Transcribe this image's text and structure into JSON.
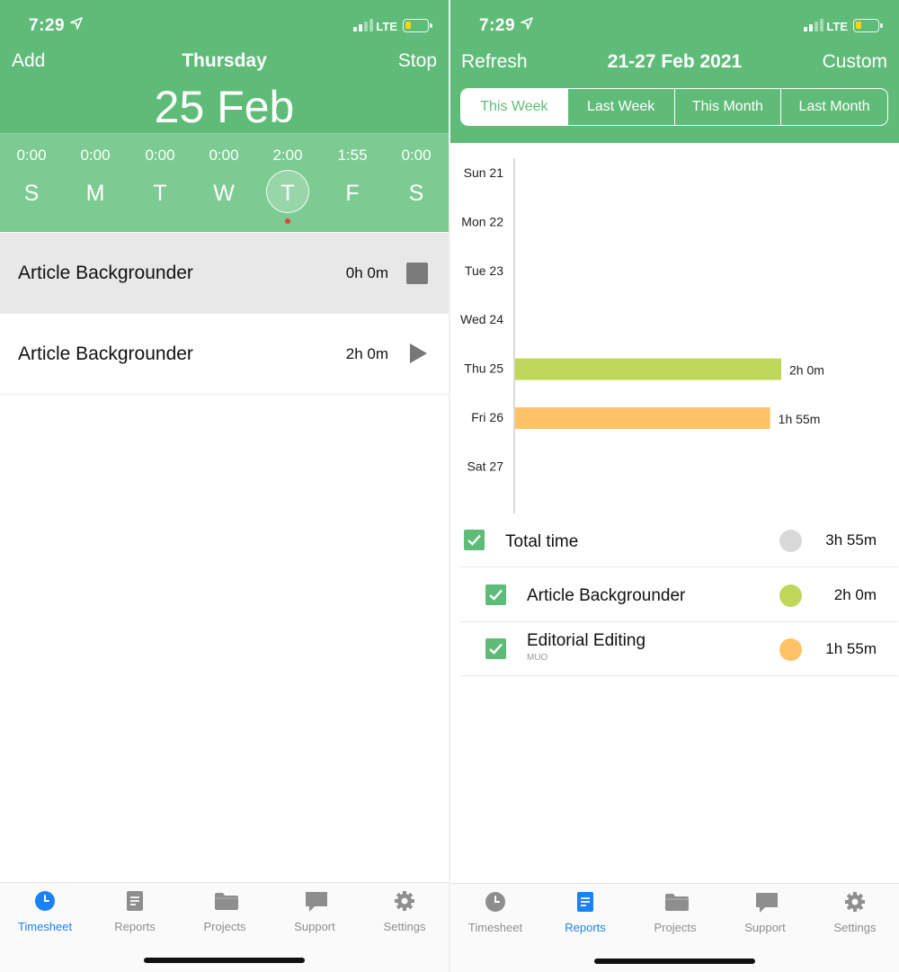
{
  "left": {
    "status": {
      "time": "7:29",
      "network": "LTE"
    },
    "nav": {
      "add": "Add",
      "title": "Thursday",
      "stop": "Stop"
    },
    "date": "25 Feb",
    "week": [
      {
        "letter": "S",
        "duration": "0:00"
      },
      {
        "letter": "M",
        "duration": "0:00"
      },
      {
        "letter": "T",
        "duration": "0:00"
      },
      {
        "letter": "W",
        "duration": "0:00"
      },
      {
        "letter": "T",
        "duration": "2:00",
        "selected": true
      },
      {
        "letter": "F",
        "duration": "1:55"
      },
      {
        "letter": "S",
        "duration": "0:00"
      }
    ],
    "entries": [
      {
        "name": "Article Backgrounder",
        "time": "0h 0m",
        "state": "running"
      },
      {
        "name": "Article Backgrounder",
        "time": "2h 0m",
        "state": "stopped"
      }
    ],
    "tabs": [
      {
        "label": "Timesheet",
        "icon": "clock-icon"
      },
      {
        "label": "Reports",
        "icon": "report-icon"
      },
      {
        "label": "Projects",
        "icon": "folder-icon"
      },
      {
        "label": "Support",
        "icon": "chat-bubble-icon"
      },
      {
        "label": "Settings",
        "icon": "gear-icon"
      }
    ],
    "active_tab": 0
  },
  "right": {
    "status": {
      "time": "7:29",
      "network": "LTE"
    },
    "nav": {
      "refresh": "Refresh",
      "title": "21-27 Feb 2021",
      "custom": "Custom"
    },
    "segments": [
      "This Week",
      "Last Week",
      "This Month",
      "Last Month"
    ],
    "selected_segment": 0,
    "legend": {
      "total": {
        "label": "Total time",
        "value": "3h 55m",
        "color": "#d9d9d9"
      },
      "items": [
        {
          "name": "Article Backgrounder",
          "subtitle": "",
          "value": "2h 0m",
          "color": "#bfd85a"
        },
        {
          "name": "Editorial Editing",
          "subtitle": "MUO",
          "value": "1h 55m",
          "color": "#ffc266"
        }
      ]
    },
    "tabs": [
      {
        "label": "Timesheet",
        "icon": "clock-icon"
      },
      {
        "label": "Reports",
        "icon": "report-icon"
      },
      {
        "label": "Projects",
        "icon": "folder-icon"
      },
      {
        "label": "Support",
        "icon": "chat-bubble-icon"
      },
      {
        "label": "Settings",
        "icon": "gear-icon"
      }
    ],
    "active_tab": 1
  },
  "colors": {
    "header_green": "#5fbc78",
    "week_green": "#7ccb92",
    "active_tab_blue": "#1a82f6",
    "article_bar": "#bfd85a",
    "editing_bar": "#ffc266"
  },
  "chart_data": {
    "type": "bar",
    "orientation": "horizontal",
    "categories": [
      "Sun 21",
      "Mon 22",
      "Tue 23",
      "Wed 24",
      "Thu 25",
      "Fri 26",
      "Sat 27"
    ],
    "values": [
      0,
      0,
      0,
      0,
      120,
      115,
      0
    ],
    "value_labels": [
      "",
      "",
      "",
      "",
      "2h 0m",
      "1h 55m",
      ""
    ],
    "bar_colors": [
      "#bfd85a",
      "#bfd85a",
      "#bfd85a",
      "#bfd85a",
      "#bfd85a",
      "#ffc266",
      "#ffc266"
    ],
    "unit": "minutes",
    "xlim": [
      0,
      120
    ],
    "grid": false,
    "title": "",
    "xlabel": "",
    "ylabel": ""
  }
}
